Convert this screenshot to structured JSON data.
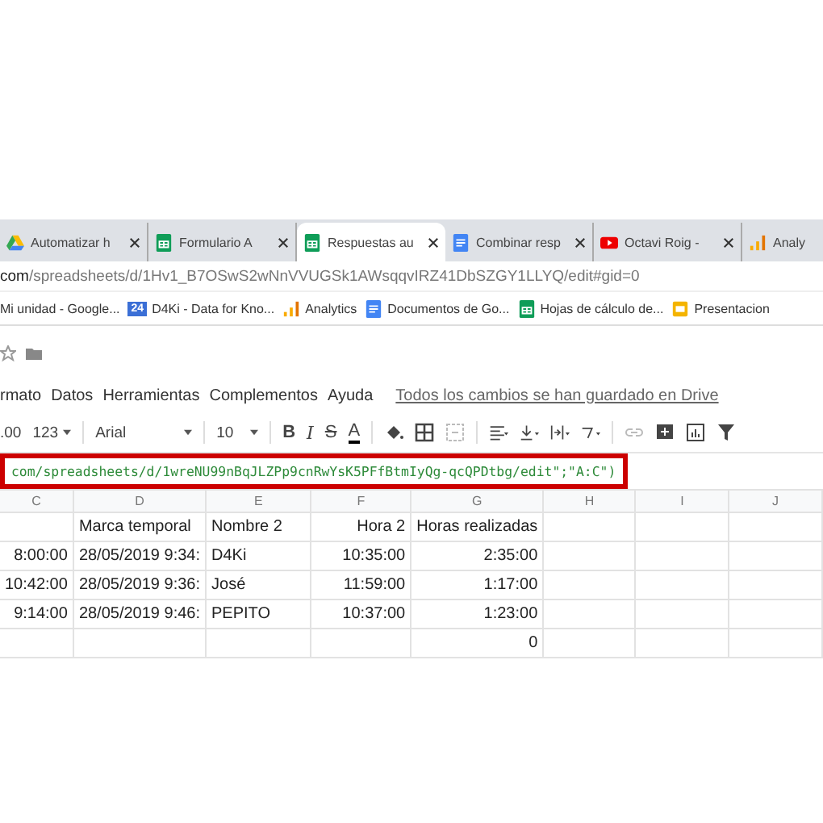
{
  "tabs": [
    {
      "label": "Automatizar h",
      "kind": "drive",
      "selected": false
    },
    {
      "label": "Formulario A",
      "kind": "sheets",
      "selected": false
    },
    {
      "label": "Respuestas au",
      "kind": "sheets",
      "selected": true
    },
    {
      "label": "Combinar resp",
      "kind": "docs",
      "selected": false
    },
    {
      "label": "Octavi Roig -",
      "kind": "youtube",
      "selected": false
    },
    {
      "label": "Analy",
      "kind": "analytics",
      "selected": false
    }
  ],
  "address": {
    "domain": "com",
    "path": "/spreadsheets/d/1Hv1_B7OSwS2wNnVVUGSk1AWsqqvIRZ41DbSZGY1LLYQ/edit#gid=0"
  },
  "bookmarks": [
    {
      "label": "Mi unidad - Google...",
      "kind": "plain"
    },
    {
      "label": "D4Ki - Data for Kno...",
      "kind": "calendar",
      "icon_text": "24"
    },
    {
      "label": "Analytics",
      "kind": "analytics"
    },
    {
      "label": "Documentos de Go...",
      "kind": "docs"
    },
    {
      "label": "Hojas de cálculo de...",
      "kind": "sheets"
    },
    {
      "label": "Presentacion",
      "kind": "slides"
    }
  ],
  "menu": [
    "rmato",
    "Datos",
    "Herramientas",
    "Complementos",
    "Ayuda"
  ],
  "save_status": "Todos los cambios se han guardado en Drive",
  "toolbar": {
    "decimals": ".00",
    "number_format": "123",
    "font": "Arial",
    "font_size": "10",
    "bold": "B",
    "italic": "I",
    "strike": "S",
    "text_color": "A"
  },
  "formula": "com/spreadsheets/d/1wreNU99nBqJLZPp9cnRwYsK5PFfBtmIyQg-qcQPDtbg/edit\";\"A:C\")",
  "columns": [
    "C",
    "D",
    "E",
    "F",
    "G",
    "H",
    "I",
    "J"
  ],
  "rows": [
    {
      "D": "Marca temporal",
      "E": "Nombre 2",
      "F": "Hora 2",
      "G": "Horas realizadas"
    },
    {
      "C": "8:00:00",
      "D": "28/05/2019 9:34:",
      "E": "D4Ki",
      "F": "10:35:00",
      "G": "2:35:00"
    },
    {
      "C": "10:42:00",
      "D": "28/05/2019 9:36:",
      "E": "José",
      "F": "11:59:00",
      "G": "1:17:00"
    },
    {
      "C": "9:14:00",
      "D": "28/05/2019 9:46:",
      "E": "PEPITO",
      "F": "10:37:00",
      "G": "1:23:00"
    },
    {
      "G": "0"
    }
  ]
}
